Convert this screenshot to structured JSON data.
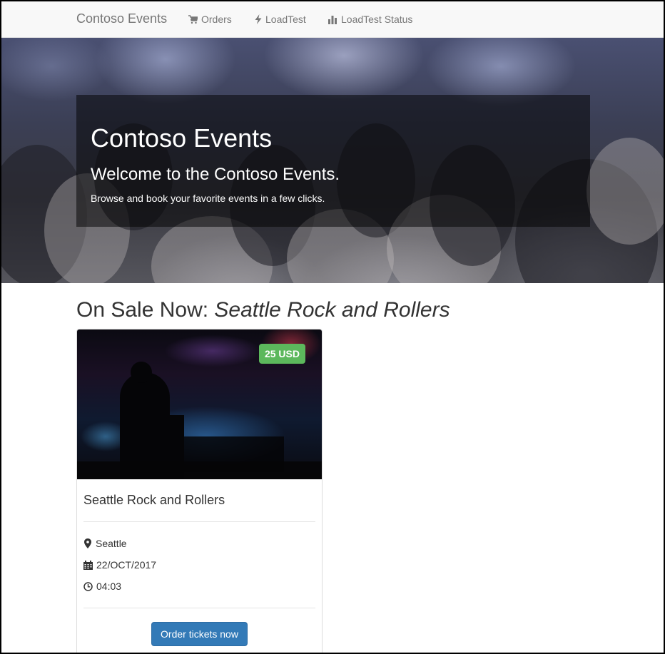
{
  "navbar": {
    "brand": "Contoso Events",
    "links": [
      {
        "label": "Orders",
        "icon": "shopping-cart-icon"
      },
      {
        "label": "LoadTest",
        "icon": "flash-icon"
      },
      {
        "label": "LoadTest Status",
        "icon": "stats-icon"
      }
    ]
  },
  "hero": {
    "title": "Contoso Events",
    "subtitle": "Welcome to the Contoso Events.",
    "text": "Browse and book your favorite events in a few clicks."
  },
  "on_sale": {
    "prefix": "On Sale Now: ",
    "event_name": "Seattle Rock and Rollers"
  },
  "event_card": {
    "price": "25 USD",
    "title": "Seattle Rock and Rollers",
    "location": "Seattle",
    "date": "22/OCT/2017",
    "time": "04:03",
    "order_button": "Order tickets now"
  },
  "colors": {
    "price_badge": "#5cb85c",
    "primary_button": "#337ab7",
    "navbar_bg": "#f8f8f8"
  }
}
